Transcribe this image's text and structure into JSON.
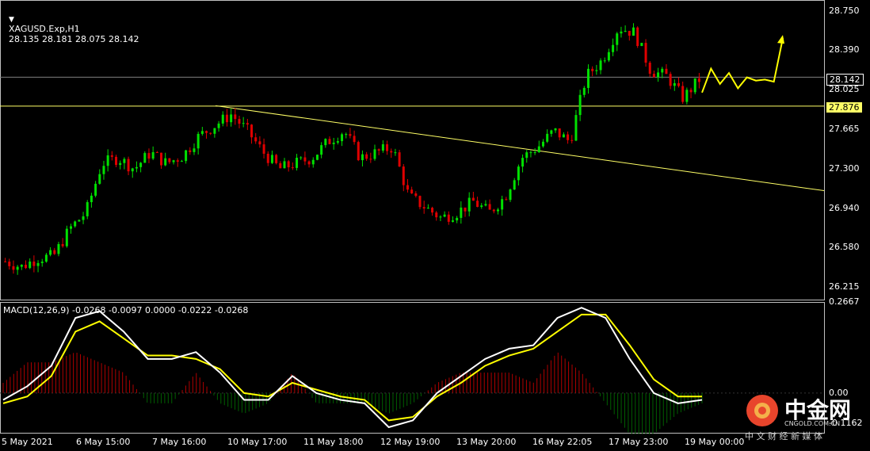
{
  "header": {
    "symbol": "XAGUSD.Exp,H1",
    "ohlc": "28.135 28.181 28.075 28.142"
  },
  "macd_header": "MACD(12,26,9) -0.0268 -0.0097 0.0000 -0.0222 -0.0268",
  "price_axis": [
    "28.750",
    "28.390",
    "28.025",
    "27.665",
    "27.300",
    "26.940",
    "26.580",
    "26.215"
  ],
  "macd_axis": [
    "0.2667",
    "0.00",
    "-0.1162"
  ],
  "current_price_tag": "28.142",
  "level_tag": "27.876",
  "time_axis": [
    "5 May 2021",
    "6 May 15:00",
    "7 May 16:00",
    "10 May 17:00",
    "11 May 18:00",
    "12 May 19:00",
    "13 May 20:00",
    "16 May 22:05",
    "17 May 23:00",
    "19 May 00:00"
  ],
  "watermark": {
    "brand_cn": "中金网",
    "url": "CNGOLD.COM.CN",
    "slogan": "中 文 财 经 新 媒 体"
  },
  "colors": {
    "background": "#000000",
    "bull": "#00e000",
    "bear": "#e00000",
    "grid_line": "#808080",
    "level_line": "#ffff66",
    "trendline": "#ffff66",
    "macd_line": "#ffffff",
    "signal_line": "#ffff00",
    "hist_pos": "#b00000",
    "hist_neg": "#006000",
    "arrow": "#ffff00"
  },
  "chart_data": [
    {
      "type": "candlestick",
      "symbol": "XAGUSD.Exp",
      "timeframe": "H1",
      "ylim": [
        26.1,
        28.85
      ],
      "yticks": [
        28.75,
        28.39,
        28.025,
        27.665,
        27.3,
        26.94,
        26.58,
        26.215
      ],
      "current_price": 28.142,
      "horizontal_level": 27.876,
      "trendline": {
        "from": [
          "7 May 16:00",
          27.88
        ],
        "to": [
          "end",
          27.1
        ]
      },
      "projection_arrows": [
        28.0,
        28.22,
        28.08,
        28.18,
        28.04,
        28.14,
        28.11,
        28.12,
        28.1,
        28.5
      ],
      "key_path": [
        26.45,
        26.4,
        26.48,
        26.5,
        26.75,
        26.9,
        27.35,
        27.4,
        27.3,
        27.45,
        27.35,
        27.42,
        27.6,
        27.7,
        27.8,
        27.65,
        27.45,
        27.3,
        27.35,
        27.4,
        27.55,
        27.65,
        27.4,
        27.45,
        27.5,
        27.05,
        26.95,
        26.85,
        26.9,
        27.0,
        26.9,
        27.05,
        27.4,
        27.5,
        27.65,
        27.55,
        28.15,
        28.3,
        28.6,
        28.55,
        28.2,
        28.15,
        27.95,
        28.12
      ]
    },
    {
      "type": "macd",
      "params": [
        12,
        26,
        9
      ],
      "values": [
        -0.0268,
        -0.0097,
        0.0,
        -0.0222,
        -0.0268
      ],
      "ylim": [
        -0.1162,
        0.2667
      ],
      "zero_line": 0.0,
      "macd_path": [
        -0.02,
        0.02,
        0.08,
        0.22,
        0.24,
        0.18,
        0.1,
        0.1,
        0.12,
        0.06,
        -0.02,
        -0.02,
        0.05,
        0.0,
        -0.02,
        -0.03,
        -0.1,
        -0.08,
        0.0,
        0.05,
        0.1,
        0.13,
        0.14,
        0.22,
        0.25,
        0.22,
        0.1,
        0.0,
        -0.03,
        -0.02
      ],
      "signal_path": [
        -0.03,
        -0.01,
        0.05,
        0.18,
        0.21,
        0.16,
        0.11,
        0.11,
        0.1,
        0.07,
        0.0,
        -0.01,
        0.03,
        0.01,
        -0.01,
        -0.02,
        -0.08,
        -0.07,
        -0.01,
        0.03,
        0.08,
        0.11,
        0.13,
        0.18,
        0.23,
        0.23,
        0.14,
        0.04,
        -0.01,
        -0.01
      ]
    }
  ]
}
